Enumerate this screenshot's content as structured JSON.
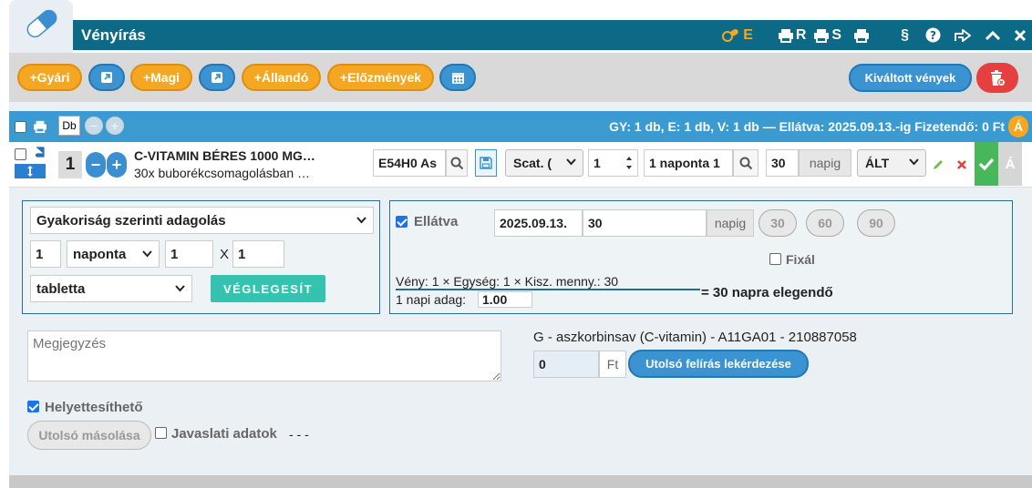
{
  "header": {
    "title": "Vényírás",
    "tools": [
      {
        "icon": "pill-e-icon",
        "label": "E"
      },
      {
        "icon": "print-r-icon",
        "label": "R"
      },
      {
        "icon": "print-s-icon",
        "label": "S"
      },
      {
        "icon": "print-icon",
        "label": ""
      },
      {
        "icon": "paragraph-icon",
        "label": "§"
      },
      {
        "icon": "help-icon",
        "label": ""
      },
      {
        "icon": "popout-icon",
        "label": ""
      },
      {
        "icon": "chevron-up-icon",
        "label": ""
      },
      {
        "icon": "close-icon",
        "label": ""
      }
    ]
  },
  "toolbar": {
    "gyari": "+Gyári",
    "magi": "+Magi",
    "allando": "+Állandó",
    "elozmenyek": "+Előzmények",
    "kivaltott": "Kiváltott vények"
  },
  "summary_bar": {
    "db_label": "Db",
    "minus": "−",
    "plus": "+",
    "summary": "GY: 1 db,  E: 1 db,  V: 1 db  —  Ellátva: 2025.09.13.-ig  Fizetendő: 0 Ft",
    "badge": "Á"
  },
  "drug_row": {
    "quantity": "1",
    "minus": "−",
    "plus": "+",
    "name": "C-VITAMIN BÉRES 1000 MG…",
    "pack": "30x buborékcsomagolásban …",
    "code": "E54H0 As",
    "usage_select": "Scat. (",
    "count": "1",
    "frequency": "1 naponta 1",
    "days": "30",
    "days_unit": "napig",
    "category_select": "ÁLT",
    "a_button": "Á"
  },
  "dosage": {
    "mode_select": "Gyakoriság szerinti adagolás",
    "amount": "1",
    "period_select": "naponta",
    "times": "1",
    "x_label": "X",
    "multiplier": "1",
    "form_select": "tabletta",
    "finalize": "VÉGLEGESÍT"
  },
  "supply": {
    "checkbox_label": "Ellátva",
    "date": "2025.09.13.",
    "days": "30",
    "days_unit": "napig",
    "quick": [
      "30",
      "60",
      "90"
    ],
    "fix_label": "Fixál",
    "formula_top": "Vény: 1 × Egység: 1 × Kisz. menny.: 30",
    "formula_bottom_label": "1 napi adag:",
    "daily_dose": "1.00",
    "result": "= 30 napra elegendő"
  },
  "details": {
    "note_placeholder": "Megjegyzés",
    "substance": "G - aszkorbinsav (C-vitamin) - A11GA01 - 210887058",
    "price": "0",
    "price_unit": "Ft",
    "last_query": "Utolsó felírás lekérdezése",
    "substitutable": "Helyettesíthető",
    "copy_last": "Utolsó másolása",
    "suggest_label": "Javaslati adatok",
    "suggest_value": "- - -"
  }
}
